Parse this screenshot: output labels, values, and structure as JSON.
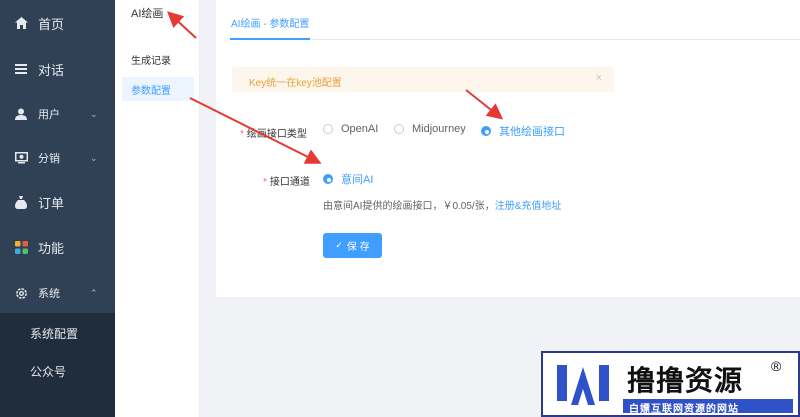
{
  "sidebar": {
    "items": [
      {
        "label": "首页",
        "icon": "home-icon"
      },
      {
        "label": "对话",
        "icon": "list-icon"
      },
      {
        "label": "用户",
        "icon": "user-icon"
      },
      {
        "label": "分销",
        "icon": "distribution-icon"
      },
      {
        "label": "订单",
        "icon": "bag-icon"
      },
      {
        "label": "功能",
        "icon": "apps-icon"
      },
      {
        "label": "系统",
        "icon": "gear-icon"
      }
    ],
    "submenu": [
      "系统配置",
      "公众号"
    ]
  },
  "subnav": {
    "title": "AI绘画",
    "items": [
      "生成记录",
      "参数配置"
    ]
  },
  "main": {
    "tab": "AI绘画 - 参数配置",
    "alert": "Key统一在key池配置",
    "alert_close": "×",
    "interface_type_label": "绘画接口类型",
    "interface_options": [
      "OpenAI",
      "Midjourney",
      "其他绘画接口"
    ],
    "selected_interface": "其他绘画接口",
    "channel_label": "接口通道",
    "channel_option": "意间AI",
    "description": "由意间AI提供的绘画接口，￥0.05/张，",
    "description_link": "注册&充值地址",
    "save_label": "保 存",
    "required_mark": "*"
  },
  "watermark": {
    "title": "撸撸资源",
    "reg": "®",
    "subtitle": "白嫖互联网资源的网站"
  },
  "colors": {
    "sidebar_bg": "#304156",
    "submenu_bg": "#1f2d3d",
    "accent": "#409eff",
    "warning_bg": "#fdf6ec",
    "warning_text": "#e6a23c",
    "arrow": "#e53935"
  }
}
